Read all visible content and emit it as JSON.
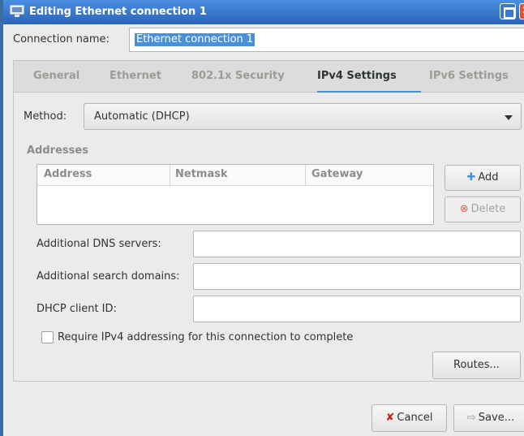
{
  "window": {
    "title": "Editing Ethernet connection 1",
    "accent": "#3a78d0",
    "icons": {
      "app": "network-icon",
      "maximize": "maximize-icon",
      "close": "close-icon"
    }
  },
  "connection": {
    "label": "Connection name:",
    "value": "Ethernet connection 1"
  },
  "tabs": [
    {
      "label": "General",
      "active": false
    },
    {
      "label": "Ethernet",
      "active": false
    },
    {
      "label": "802.1x Security",
      "active": false
    },
    {
      "label": "IPv4 Settings",
      "active": true
    },
    {
      "label": "IPv6 Settings",
      "active": false
    }
  ],
  "ipv4": {
    "method_label": "Method:",
    "method_value": "Automatic (DHCP)",
    "addresses_title": "Addresses",
    "columns": [
      "Address",
      "Netmask",
      "Gateway"
    ],
    "add_label": "Add",
    "delete_label": "Delete",
    "dns_label": "Additional DNS servers:",
    "dns_value": "",
    "search_label": "Additional search domains:",
    "search_value": "",
    "dhcp_label": "DHCP client ID:",
    "dhcp_value": "",
    "require_label": "Require IPv4 addressing for this connection to complete",
    "require_checked": false,
    "routes_label": "Routes..."
  },
  "footer": {
    "cancel_label": "Cancel",
    "save_label": "Save..."
  }
}
